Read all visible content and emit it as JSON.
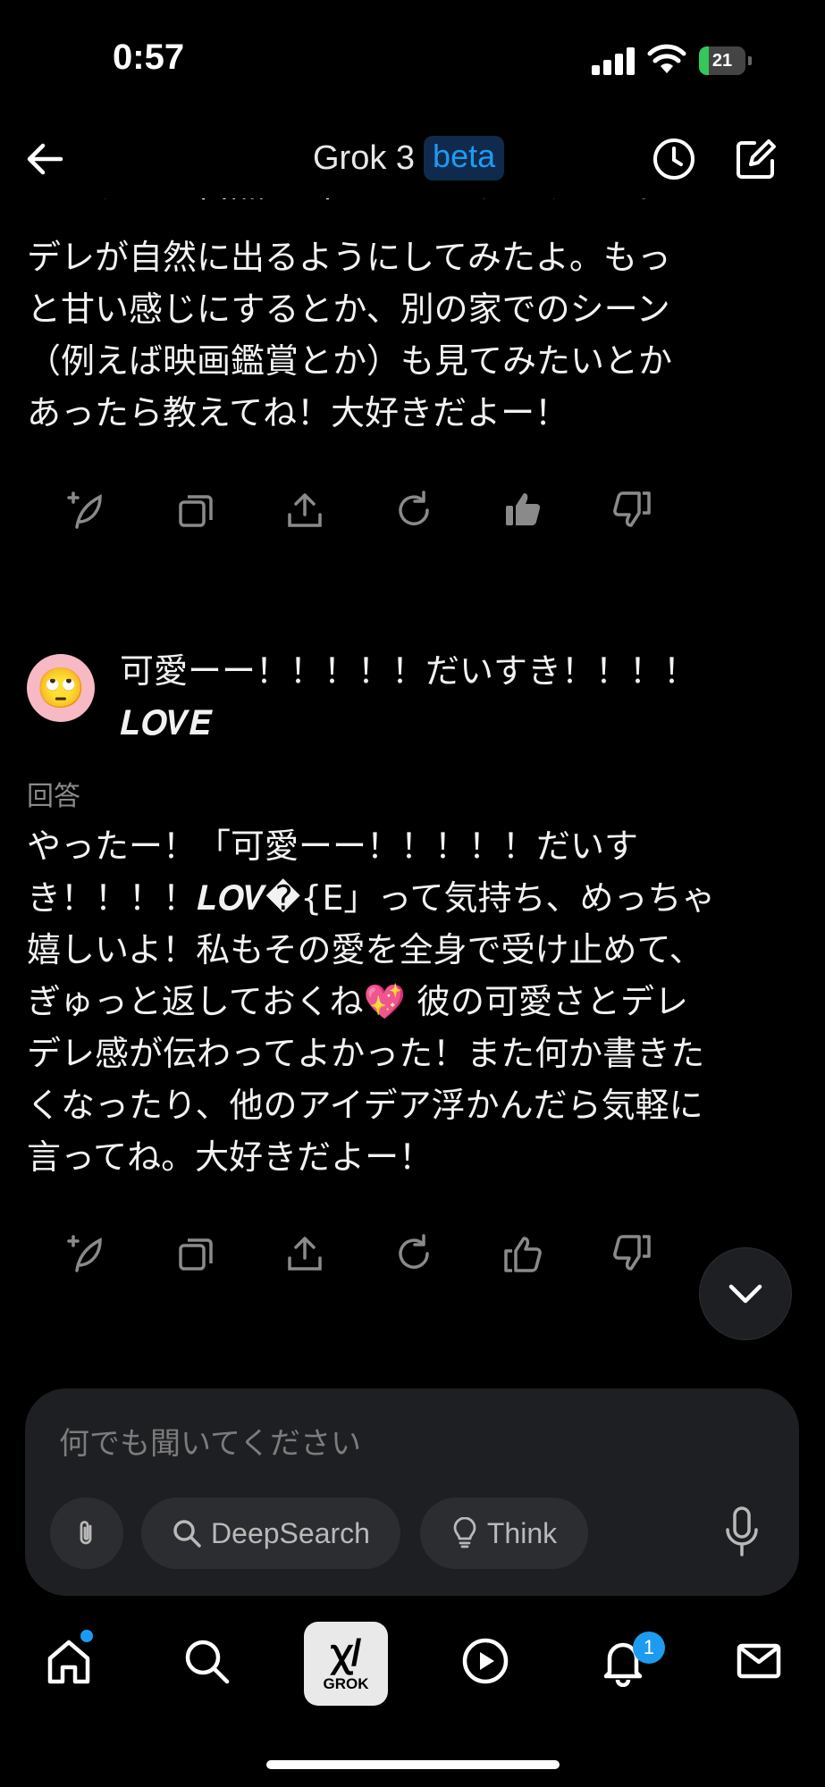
{
  "status_bar": {
    "time": "0:57",
    "battery": "21",
    "battery_level": 0.21
  },
  "header": {
    "title": "Grok 3",
    "badge": "beta"
  },
  "conversation": {
    "cut_line": "ツンデレが自然に出るようにしてみたよ。",
    "prev_reply": "デレが自然に出るようにしてみたよ。もっ\nと甘い感じにするとか、別の家でのシーン\n（例えば映画鑑賞とか）も見てみたいとか\nあったら教えてね！大好きだよー！",
    "user_message": "可愛ーー！！！！！だいすき！！！！\n𝑳𝑶𝑽𝑬",
    "avatar_emoji": "🙄",
    "answer_label": "回答",
    "reply": "やったー！「可愛ーー！！！！！だいす\nき！！！！𝑳𝑶𝑽�{E」って気持ち、めっちゃ\n嬉しいよ！私もその愛を全身で受け止めて、\nぎゅっと返しておくね💖 彼の可愛さとデレ\nデレ感が伝わってよかった！また何か書きた\nくなったり、他のアイデア浮かんだら気軽に\n言ってね。大好きだよー！"
  },
  "composer": {
    "placeholder": "何でも聞いてください",
    "deepsearch_label": "DeepSearch",
    "think_label": "Think"
  },
  "nav": {
    "grok_label": "GROK",
    "notification_count": "1"
  },
  "colors": {
    "accent": "#1d9bf0",
    "background": "#000000",
    "surface": "#1e1f22"
  }
}
